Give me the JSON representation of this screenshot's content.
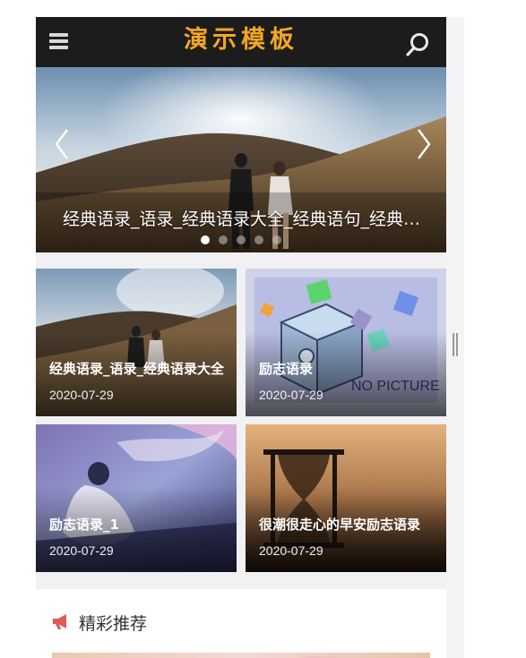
{
  "header": {
    "title": "演示模板",
    "menu_icon": "hamburger-menu-icon",
    "search_icon": "search-icon"
  },
  "banner": {
    "caption": "经典语录_语录_经典语录大全_经典语句_经典句子",
    "slide_count": 5,
    "active_slide": 1
  },
  "grid": [
    {
      "title": "经典语录_语录_经典语录大全",
      "date": "2020-07-29"
    },
    {
      "title": "励志语录",
      "date": "2020-07-29"
    },
    {
      "title": "励志语录_1",
      "date": "2020-07-29"
    },
    {
      "title": "很潮很走心的早安励志语录",
      "date": "2020-07-29"
    }
  ],
  "recommend": {
    "title": "精彩推荐",
    "icon": "megaphone-icon",
    "icon_color": "#e05a5a"
  },
  "colors": {
    "title_accent": "#f5a623",
    "header_bg": "#1c1c1c"
  }
}
